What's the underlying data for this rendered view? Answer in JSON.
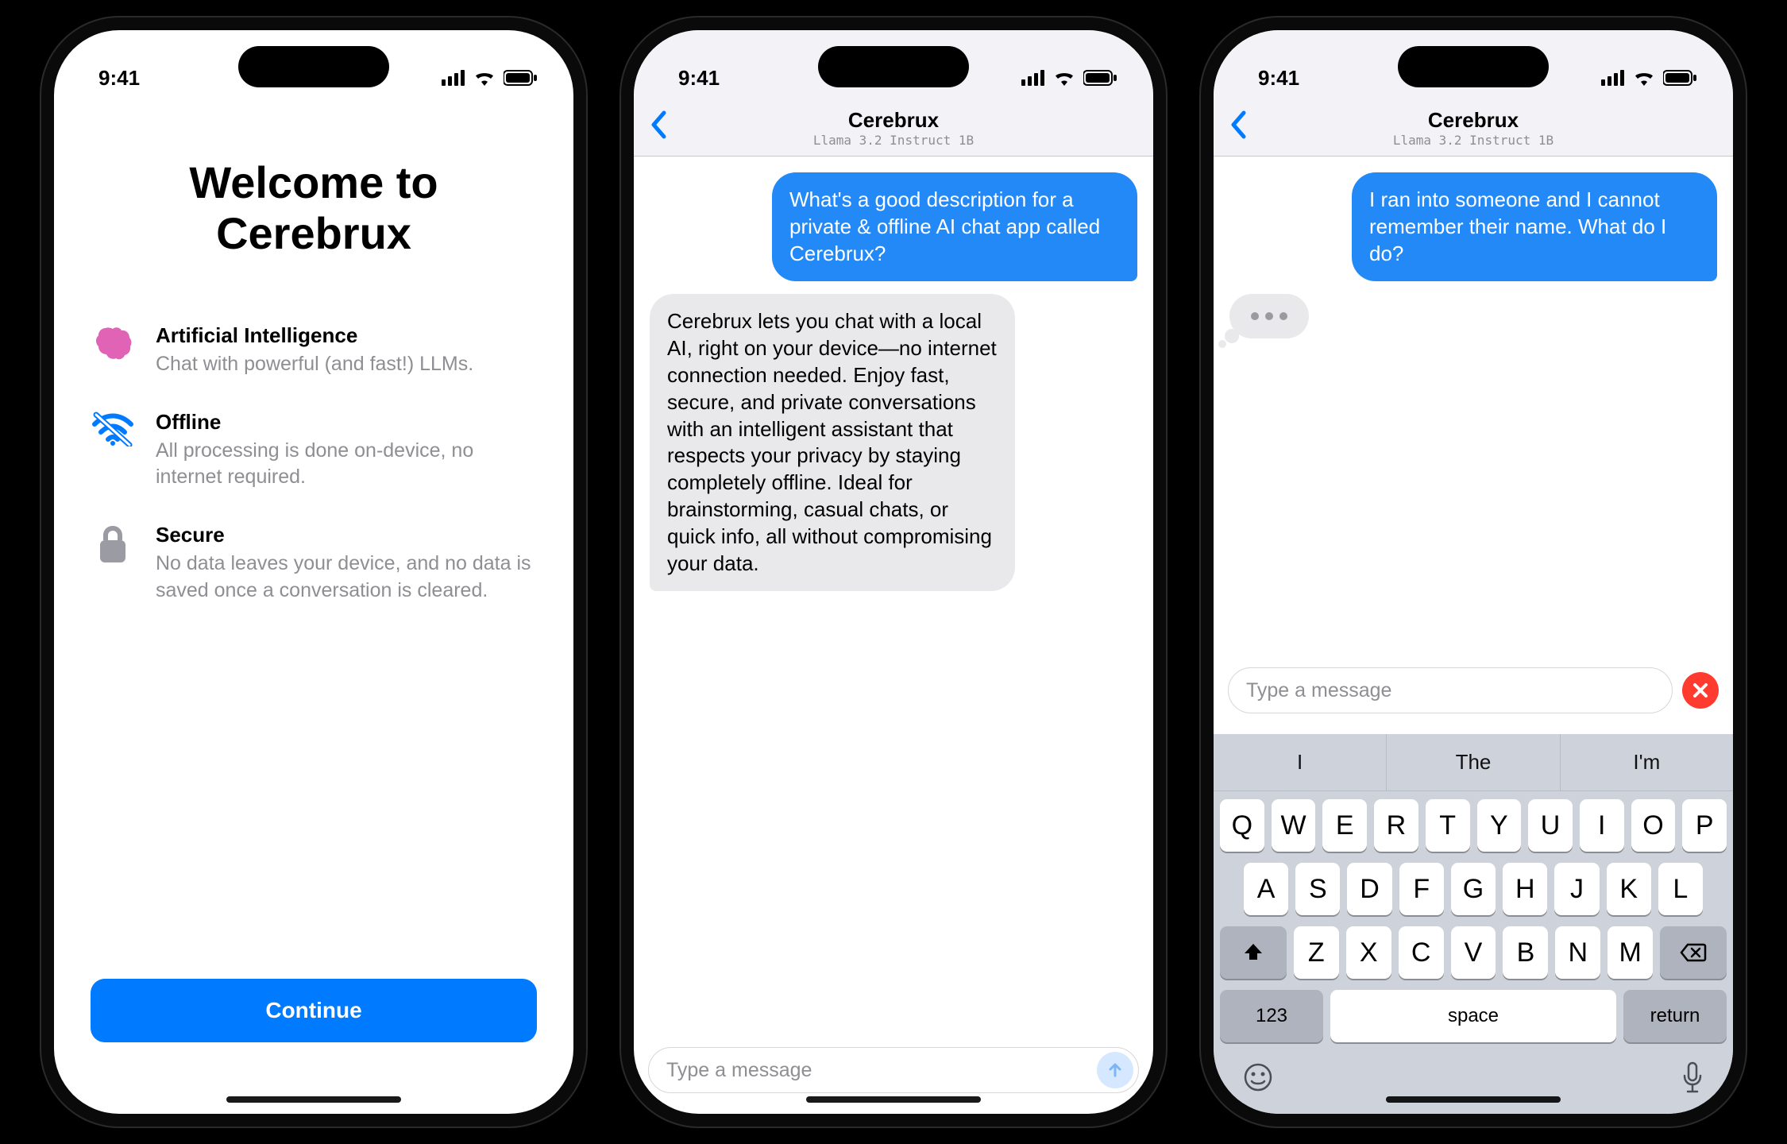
{
  "status": {
    "time": "9:41"
  },
  "screen1": {
    "title_line1": "Welcome to",
    "title_line2": "Cerebrux",
    "features": [
      {
        "title": "Artificial Intelligence",
        "desc": "Chat with powerful (and fast!) LLMs."
      },
      {
        "title": "Offline",
        "desc": "All processing is done on-device, no internet required."
      },
      {
        "title": "Secure",
        "desc": "No data leaves your device, and no data is saved once a conversation is cleared."
      }
    ],
    "cta": "Continue"
  },
  "chat_header": {
    "title": "Cerebrux",
    "subtitle": "Llama 3.2 Instruct 1B"
  },
  "screen2": {
    "user_msg": "What's a good description for a private & offline AI chat app called Cerebrux?",
    "ai_msg": "Cerebrux lets you chat with a local AI, right on your device—no internet connection needed. Enjoy fast, secure, and private conversations with an intelligent assistant that respects your privacy by staying completely offline. Ideal for brainstorming, casual chats, or quick info, all without compromising your data."
  },
  "screen3": {
    "user_msg": "I ran into someone and I cannot remember their name. What do I do?"
  },
  "composer": {
    "placeholder": "Type a message"
  },
  "keyboard": {
    "suggestions": [
      "I",
      "The",
      "I'm"
    ],
    "rows": [
      [
        "Q",
        "W",
        "E",
        "R",
        "T",
        "Y",
        "U",
        "I",
        "O",
        "P"
      ],
      [
        "A",
        "S",
        "D",
        "F",
        "G",
        "H",
        "J",
        "K",
        "L"
      ],
      [
        "Z",
        "X",
        "C",
        "V",
        "B",
        "N",
        "M"
      ]
    ],
    "num": "123",
    "space": "space",
    "ret": "return"
  }
}
